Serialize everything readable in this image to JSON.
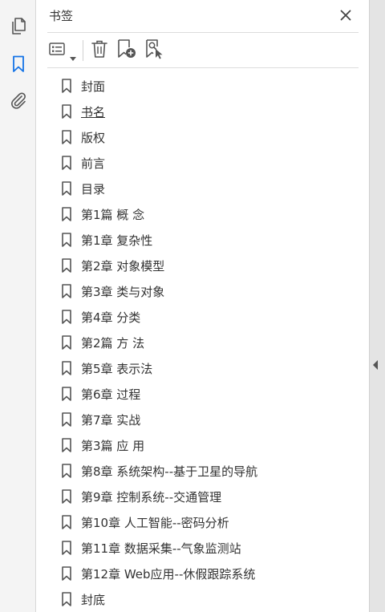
{
  "rail": {
    "items": [
      {
        "name": "page-thumbnails-icon"
      },
      {
        "name": "bookmarks-icon"
      },
      {
        "name": "attachments-icon"
      }
    ]
  },
  "panel": {
    "title": "书签",
    "toolbar": {
      "options_icon": "list-options-icon",
      "delete_icon": "trash-icon",
      "new_bookmark_icon": "new-bookmark-icon",
      "find_bookmark_icon": "find-current-bookmark-icon"
    }
  },
  "bookmarks": [
    {
      "label": "封面",
      "underline": false
    },
    {
      "label": "书名",
      "underline": true
    },
    {
      "label": "版权",
      "underline": false
    },
    {
      "label": "前言",
      "underline": false
    },
    {
      "label": "目录",
      "underline": false
    },
    {
      "label": "第1篇 概 念",
      "underline": false
    },
    {
      "label": "第1章 复杂性",
      "underline": false
    },
    {
      "label": "第2章 对象模型",
      "underline": false
    },
    {
      "label": "第3章 类与对象",
      "underline": false
    },
    {
      "label": "第4章 分类",
      "underline": false
    },
    {
      "label": "第2篇 方 法",
      "underline": false
    },
    {
      "label": "第5章 表示法",
      "underline": false
    },
    {
      "label": "第6章 过程",
      "underline": false
    },
    {
      "label": "第7章 实战",
      "underline": false
    },
    {
      "label": "第3篇 应 用",
      "underline": false
    },
    {
      "label": "第8章 系统架构--基于卫星的导航",
      "underline": false
    },
    {
      "label": "第9章 控制系统--交通管理",
      "underline": false
    },
    {
      "label": "第10章 人工智能--密码分析",
      "underline": false
    },
    {
      "label": "第11章 数据采集--气象监测站",
      "underline": false
    },
    {
      "label": "第12章 Web应用--休假跟踪系统",
      "underline": false
    },
    {
      "label": "封底",
      "underline": false
    }
  ],
  "colors": {
    "accent": "#1473e6",
    "icon": "#555555"
  }
}
